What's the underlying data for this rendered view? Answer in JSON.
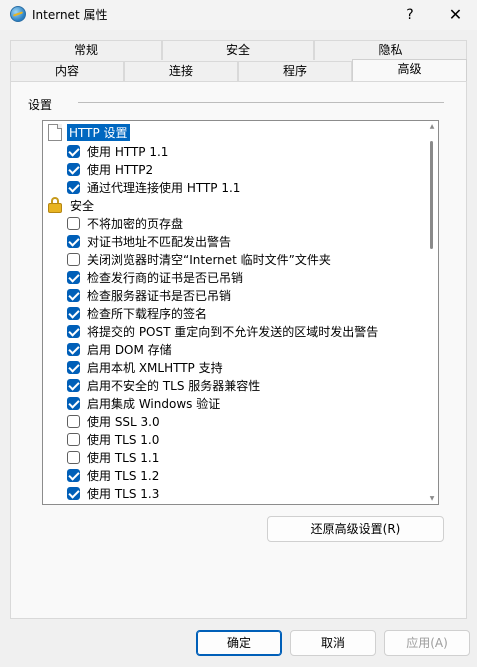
{
  "window": {
    "title": "Internet 属性",
    "help_label": "?",
    "close_label": "✕"
  },
  "tabs": {
    "row1": [
      "常规",
      "安全",
      "隐私"
    ],
    "row2": [
      "内容",
      "连接",
      "程序",
      "高级"
    ],
    "active": "高级"
  },
  "settings": {
    "group_label": "设置",
    "items": [
      {
        "type": "category",
        "icon": "document-icon",
        "label": "HTTP 设置"
      },
      {
        "type": "checkbox",
        "checked": true,
        "label": "使用 HTTP 1.1"
      },
      {
        "type": "checkbox",
        "checked": true,
        "label": "使用 HTTP2"
      },
      {
        "type": "checkbox",
        "checked": true,
        "label": "通过代理连接使用 HTTP 1.1"
      },
      {
        "type": "category",
        "icon": "lock-icon",
        "label": "安全"
      },
      {
        "type": "checkbox",
        "checked": false,
        "label": "不将加密的页存盘"
      },
      {
        "type": "checkbox",
        "checked": true,
        "label": "对证书地址不匹配发出警告"
      },
      {
        "type": "checkbox",
        "checked": false,
        "label": "关闭浏览器时清空“Internet 临时文件”文件夹"
      },
      {
        "type": "checkbox",
        "checked": true,
        "label": "检查发行商的证书是否已吊销"
      },
      {
        "type": "checkbox",
        "checked": true,
        "label": "检查服务器证书是否已吊销"
      },
      {
        "type": "checkbox",
        "checked": true,
        "label": "检查所下载程序的签名"
      },
      {
        "type": "checkbox",
        "checked": true,
        "label": "将提交的 POST 重定向到不允许发送的区域时发出警告"
      },
      {
        "type": "checkbox",
        "checked": true,
        "label": "启用 DOM 存储"
      },
      {
        "type": "checkbox",
        "checked": true,
        "label": "启用本机 XMLHTTP 支持"
      },
      {
        "type": "checkbox",
        "checked": true,
        "label": "启用不安全的 TLS 服务器兼容性"
      },
      {
        "type": "checkbox",
        "checked": true,
        "label": "启用集成 Windows 验证"
      },
      {
        "type": "checkbox",
        "checked": false,
        "label": "使用 SSL 3.0"
      },
      {
        "type": "checkbox",
        "checked": false,
        "label": "使用 TLS 1.0"
      },
      {
        "type": "checkbox",
        "checked": false,
        "label": "使用 TLS 1.1"
      },
      {
        "type": "checkbox",
        "checked": true,
        "label": "使用 TLS 1.2"
      },
      {
        "type": "checkbox",
        "checked": true,
        "label": "使用 TLS 1.3"
      }
    ]
  },
  "buttons": {
    "restore": "还原高级设置(R)",
    "ok": "确定",
    "cancel": "取消",
    "apply": "应用(A)"
  },
  "colors": {
    "accent": "#005fb8",
    "selection": "#0067c0"
  }
}
